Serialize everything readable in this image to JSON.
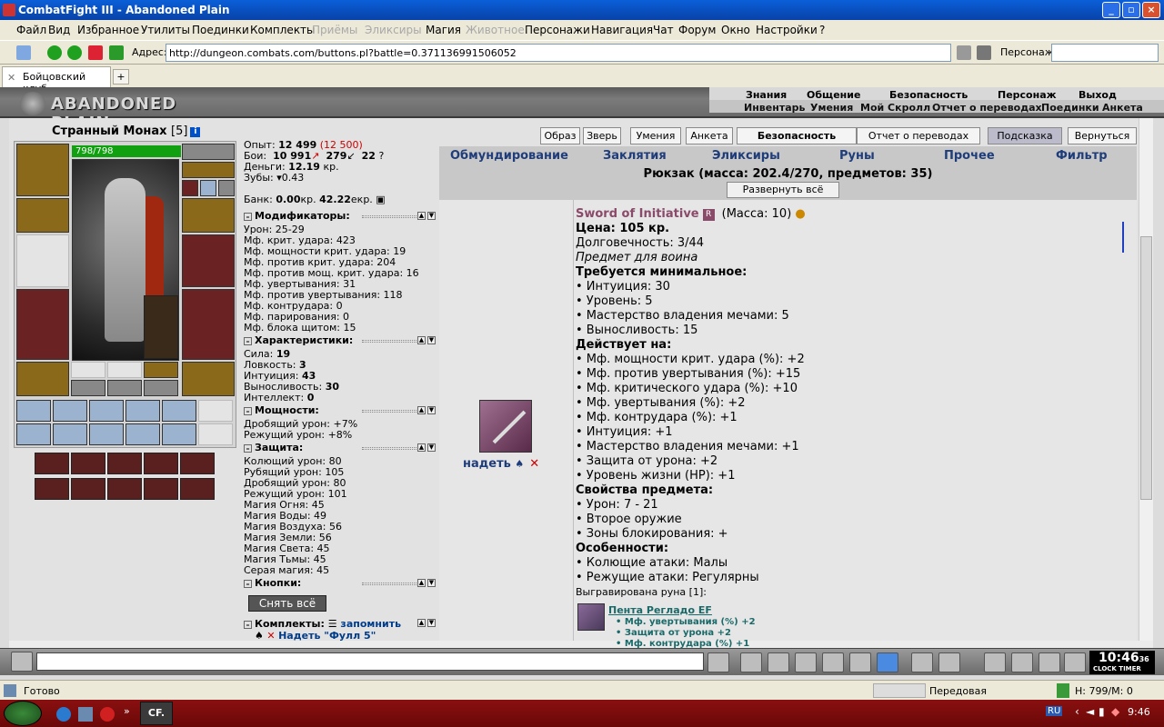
{
  "window": {
    "title": "CombatFight III - Abandoned Plain"
  },
  "menu": [
    "Файл",
    "Вид",
    "Избранное",
    "Утилиты",
    "Поединки",
    "Комплекты",
    "Приёмы",
    "Эликсиры",
    "Магия",
    "Животное",
    "Персонажи",
    "Навигация",
    "Чат",
    "Форум",
    "Окно",
    "Настройки",
    "?"
  ],
  "address": {
    "label": "Адрес:",
    "url": "http://dungeon.combats.com/buttons.pl?battle=0.371136991506052",
    "persona_label": "Персонаж:"
  },
  "tab": {
    "title": "Бойцовский клуб"
  },
  "game": {
    "logo": "ABANDONED PLAIN",
    "topnav": [
      "Знания",
      "Общение",
      "Безопасность",
      "Персонаж",
      "Выход"
    ],
    "subnav": [
      "Инвентарь",
      "Умения",
      "Мой Скролл",
      "Отчет о переводах",
      "Поединки",
      "Анкета"
    ]
  },
  "character": {
    "name": "Странный Монах",
    "level": "[5]",
    "hp": "798/798"
  },
  "stats": {
    "exp_label": "Опыт:",
    "exp": "12 499",
    "exp_next": "(12 500)",
    "fights_label": "Бои:",
    "wins": "10 991",
    "losses": "279",
    "draws": "22",
    "money_label": "Деньги:",
    "money": "12.19",
    "money_unit": "кр.",
    "teeth_label": "Зубы:",
    "teeth": "0.43",
    "bank_label": "Банк:",
    "bank": "0.00",
    "bank_kr": "кр.",
    "bank_ekr": "42.22",
    "bank_ekr_unit": "екр.",
    "sections": {
      "modifiers": "Модификаторы:",
      "characteristics": "Характеристики:",
      "powers": "Мощности:",
      "protection": "Защита:",
      "buttons": "Кнопки:",
      "sets": "Комплекты:"
    },
    "mods": [
      "Урон: 25-29",
      "Мф. крит. удара: 423",
      "Мф. мощности крит. удара: 19",
      "Мф. против крит. удара: 204",
      "Мф. против мощ. крит. удара: 16",
      "Мф. увертывания: 31",
      "Мф. против увертывания: 118",
      "Мф. контрудара: 0",
      "Мф. парирования: 0",
      "Мф. блока щитом: 15"
    ],
    "chars": [
      {
        "k": "Сила: ",
        "v": "19"
      },
      {
        "k": "Ловкость: ",
        "v": "3"
      },
      {
        "k": "Интуиция: ",
        "v": "43"
      },
      {
        "k": "Выносливость: ",
        "v": "30"
      },
      {
        "k": "Интеллект: ",
        "v": "0"
      }
    ],
    "powers": [
      "Дробящий урон: +7%",
      "Режущий урон: +8%"
    ],
    "protection": [
      "Колющий урон: 80",
      "Рубящий урон: 105",
      "Дробящий урон: 80",
      "Режущий урон: 101",
      "Магия Огня: 45",
      "Магия Воды: 49",
      "Магия Воздуха: 56",
      "Магия Земли: 56",
      "Магия Света: 45",
      "Магия Тьмы: 45",
      "Серая магия: 45"
    ],
    "remove_all": "Снять всё",
    "remember": "запомнить",
    "set_item": "Надеть \"Фулл 5\""
  },
  "topbuttons": [
    "Образ",
    "Зверь",
    "Умения",
    "Анкета",
    "Безопасность",
    "Отчет о переводах",
    "Подсказка",
    "Вернуться"
  ],
  "invtabs": [
    "Обмундирование",
    "Заклятия",
    "Эликсиры",
    "Руны",
    "Прочее",
    "Фильтр"
  ],
  "inventory": {
    "title": "Рюкзак (масса: 202.4/270, предметов: 35)",
    "expand": "Развернуть всё"
  },
  "item": {
    "name": "Sword of Initiative",
    "badge": "R",
    "mass": "(Масса: 10)",
    "wear": "надеть",
    "price": "Цена: 105 кр.",
    "durability": "Долговечность: 3/44",
    "for": "Предмет для воина",
    "req_title": "Требуется минимальное:",
    "reqs": [
      "• Интуиция: 30",
      "• Уровень: 5",
      "• Мастерство владения мечами: 5",
      "• Выносливость: 15"
    ],
    "acts_title": "Действует на:",
    "acts": [
      "• Мф. мощности крит. удара (%): +2",
      "• Мф. против увертывания (%): +15",
      "• Мф. критического удара (%): +10",
      "• Мф. увертывания (%): +2",
      "• Мф. контрудара (%): +1",
      "• Интуиция: +1",
      "• Мастерство владения мечами: +1",
      "• Защита от урона: +2",
      "• Уровень жизни (HP): +1"
    ],
    "props_title": "Свойства предмета:",
    "props": [
      "• Урон: 7 - 21",
      "• Второе оружие",
      "• Зоны блокирования: +"
    ],
    "feat_title": "Особенности:",
    "feats": [
      "• Колющие атаки: Малы",
      "• Режущие атаки: Регулярны"
    ],
    "rune_title": "Выгравирована руна [1]:",
    "rune_name": "Пента Регладо EF",
    "rune_lines": [
      "• Мф. увертывания (%) +2",
      "• Защита от урона +2",
      "• Мф. контрудара (%) +1"
    ]
  },
  "clock": {
    "time": "10:46",
    "sec": "36",
    "labels": "CLOCK TIMER"
  },
  "status": {
    "left": "Готово",
    "mid": "Передовая",
    "right": "Н: 799/М: 0"
  },
  "tray": {
    "lang": "RU",
    "time": "9:46"
  },
  "taskbar": {
    "app": "CF."
  }
}
